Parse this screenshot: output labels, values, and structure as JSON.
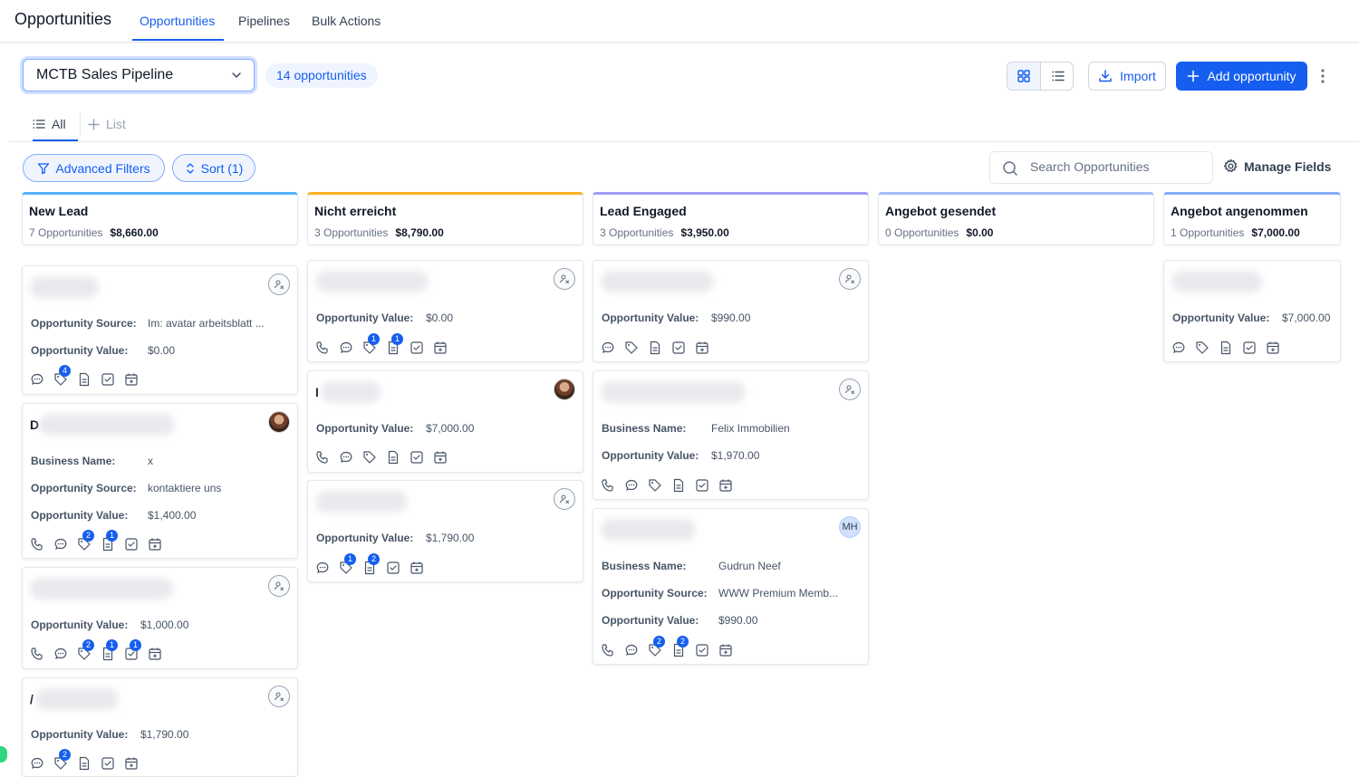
{
  "header": {
    "title": "Opportunities",
    "tabs": [
      "Opportunities",
      "Pipelines",
      "Bulk Actions"
    ]
  },
  "toolbar": {
    "pipeline": "MCTB Sales Pipeline",
    "count_badge": "14 opportunities",
    "import_label": "Import",
    "add_label": "Add opportunity"
  },
  "smartlists": {
    "all": "All",
    "add": "List"
  },
  "filters": {
    "advanced": "Advanced Filters",
    "sort": "Sort (1)",
    "search_placeholder": "Search Opportunities",
    "manage_fields": "Manage Fields"
  },
  "labels": {
    "source": "Opportunity Source:",
    "value": "Opportunity Value:",
    "business": "Business Name:"
  },
  "colors": {
    "accent": "#155eef",
    "col_new_lead": "#53b1fd",
    "col_nicht_erreicht": "#fdb022",
    "col_lead_engaged": "#9e9efc",
    "col_angebot_gesendet": "#a4bcfd",
    "col_angebot_angenommen": "#84adff"
  },
  "columns": [
    {
      "name": "New Lead",
      "count": "7 Opportunities",
      "total": "$8,660.00",
      "cards": [
        {
          "source": "Im: avatar arbeitsblatt ...",
          "value": "$0.00",
          "badges": {
            "chat": null,
            "tag": "4"
          }
        },
        {
          "initial": "D",
          "business": "x",
          "source": "kontaktiere uns",
          "value": "$1,400.00",
          "badges": {
            "tag": "2",
            "note": "1"
          }
        },
        {
          "value": "$1,000.00",
          "badges": {
            "tag": "2",
            "note": "1",
            "task": "1"
          }
        },
        {
          "initial": "/",
          "value": "$1,790.00",
          "badges": {
            "tag": "2"
          }
        }
      ]
    },
    {
      "name": "Nicht erreicht",
      "count": "3 Opportunities",
      "total": "$8,790.00",
      "cards": [
        {
          "value": "$0.00",
          "badges": {
            "tag": "1",
            "note": "1"
          }
        },
        {
          "initial": "I",
          "value": "$7,000.00"
        },
        {
          "value": "$1,790.00",
          "badges": {
            "tag": "1",
            "note": "2"
          }
        }
      ]
    },
    {
      "name": "Lead Engaged",
      "count": "3 Opportunities",
      "total": "$3,950.00",
      "cards": [
        {
          "value": "$990.00"
        },
        {
          "business": "Felix Immobilien",
          "value": "$1,970.00"
        },
        {
          "business": "Gudrun Neef",
          "source": "WWW Premium Memb...",
          "value": "$990.00",
          "avatar": "MH",
          "badges": {
            "tag": "2",
            "note": "2"
          }
        }
      ]
    },
    {
      "name": "Angebot gesendet",
      "count": "0 Opportunities",
      "total": "$0.00",
      "cards": []
    },
    {
      "name": "Angebot angenommen",
      "count": "1 Opportunities",
      "total": "$7,000.00",
      "cards": [
        {
          "value": "$7,000.00"
        }
      ]
    }
  ]
}
